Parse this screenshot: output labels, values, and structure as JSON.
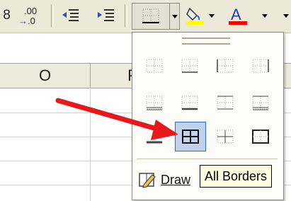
{
  "toolbar": {
    "decimal_remove_label": "8",
    "decrease_decimal_label": ".00→.0",
    "decrease_decimal_top": ".00",
    "decrease_decimal_bottom": "→.0",
    "border_color": "#000000",
    "fill_color": "#ffff00",
    "font_color": "#ff0000",
    "font_color_letter": "A"
  },
  "sheet": {
    "columns": [
      "O",
      "P"
    ]
  },
  "borders_menu": {
    "draw_label": "Draw",
    "options": [
      "no-border",
      "bottom-border",
      "left-border",
      "right-border",
      "bottom-double-border",
      "top-and-bottom-border",
      "top-and-double-bottom-border",
      "top-and-thick-bottom-border",
      "thick-bottom-border",
      "all-borders",
      "inside-borders",
      "outside-borders"
    ]
  },
  "tooltip": {
    "text": "All Borders"
  },
  "annotation": {
    "arrow_color": "#e8171c"
  }
}
